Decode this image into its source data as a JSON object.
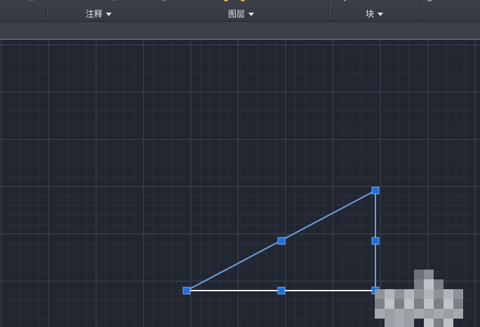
{
  "ribbon": {
    "panels": [
      {
        "id": "annotate",
        "label": "注释"
      },
      {
        "id": "layers",
        "label": "图层"
      },
      {
        "id": "block",
        "label": "块"
      }
    ]
  },
  "drawing": {
    "shape": "right-triangle",
    "selected": true,
    "line_color": "#6f9fe0",
    "base_line_color": "#e8ecf2",
    "grip_color": "#1f6fe0",
    "grid_color": "#2f3541",
    "grid_major_color": "#394050"
  }
}
